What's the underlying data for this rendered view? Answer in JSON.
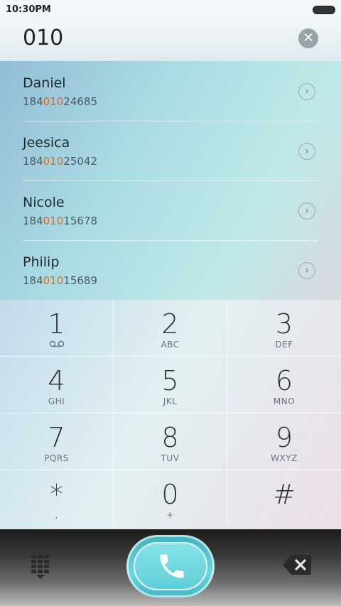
{
  "status": {
    "time": "10:30PM"
  },
  "search": {
    "query": "010",
    "clear_label": "✕"
  },
  "contacts": [
    {
      "name": "Daniel",
      "num_pre": "184",
      "num_hl": "010",
      "num_post": "24685"
    },
    {
      "name": "Jeesica",
      "num_pre": "184",
      "num_hl": "010",
      "num_post": "25042"
    },
    {
      "name": "Nicole",
      "num_pre": "184",
      "num_hl": "010",
      "num_post": "15678"
    },
    {
      "name": "Philip",
      "num_pre": "184",
      "num_hl": "010",
      "num_post": "15689"
    }
  ],
  "keypad": [
    {
      "digit": "1",
      "letters": ""
    },
    {
      "digit": "2",
      "letters": "ABC"
    },
    {
      "digit": "3",
      "letters": "DEF"
    },
    {
      "digit": "4",
      "letters": "GHI"
    },
    {
      "digit": "5",
      "letters": "JKL"
    },
    {
      "digit": "6",
      "letters": "MNO"
    },
    {
      "digit": "7",
      "letters": "PQRS"
    },
    {
      "digit": "8",
      "letters": "TUV"
    },
    {
      "digit": "9",
      "letters": "WXYZ"
    },
    {
      "digit": "*",
      "letters": ","
    },
    {
      "digit": "0",
      "letters": "+"
    },
    {
      "digit": "#",
      "letters": ""
    }
  ],
  "colors": {
    "highlight": "#e06a1d",
    "call_accent": "#5fcfd8"
  },
  "icons": {
    "voicemail": "voicemail-icon",
    "dialpad": "dialpad-icon",
    "call": "phone-icon",
    "backspace": "backspace-icon",
    "chevron": "chevron-right-icon"
  }
}
